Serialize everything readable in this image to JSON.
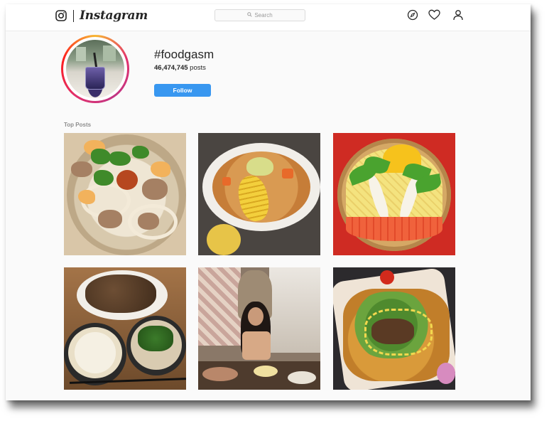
{
  "nav": {
    "brand_wordmark": "Instagram",
    "search_placeholder": "Search",
    "icons": [
      "instagram-glyph-icon",
      "search-icon",
      "compass-icon",
      "heart-icon",
      "person-icon"
    ]
  },
  "hashtag": {
    "title": "#foodgasm",
    "post_count": "46,474,745",
    "post_count_suffix": " posts",
    "follow_label": "Follow"
  },
  "section": {
    "label": "Top Posts"
  },
  "colors": {
    "follow_button": "#3897f0",
    "text_primary": "#262626",
    "text_secondary": "#8e8e8e"
  }
}
